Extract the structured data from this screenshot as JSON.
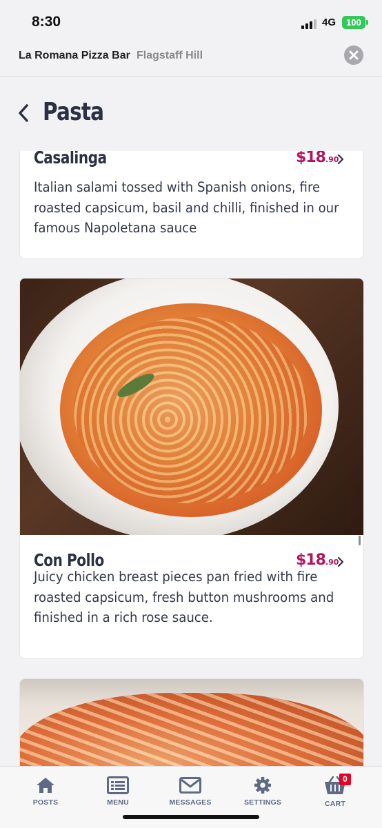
{
  "status_bar": {
    "time": "8:30",
    "network": "4G",
    "battery": "100"
  },
  "header": {
    "store_name": "La Romana Pizza Bar",
    "location": "Flagstaff Hill"
  },
  "page": {
    "title": "Pasta"
  },
  "items": [
    {
      "name": "Casalinga",
      "price_dollars": "$18",
      "price_cents": ".90",
      "description": "Italian salami tossed with Spanish onions, fire roasted capsicum, basil and chilli, finished in our famous Napoletana sauce"
    },
    {
      "name": "Con Pollo",
      "price_dollars": "$18",
      "price_cents": ".90",
      "description": "Juicy chicken breast pieces pan fried with fire roasted capsicum, fresh button mushrooms and finished in a rich rose sauce."
    }
  ],
  "tabs": [
    {
      "label": "POSTS",
      "icon": "home-icon"
    },
    {
      "label": "MENU",
      "icon": "menu-list-icon"
    },
    {
      "label": "MESSAGES",
      "icon": "envelope-icon"
    },
    {
      "label": "SETTINGS",
      "icon": "gear-icon"
    },
    {
      "label": "CART",
      "icon": "cart-icon",
      "badge": "0"
    }
  ],
  "colors": {
    "accent_price": "#b3145e",
    "title": "#2b3043",
    "tab_icon": "#5e6a84",
    "badge": "#e60023"
  }
}
